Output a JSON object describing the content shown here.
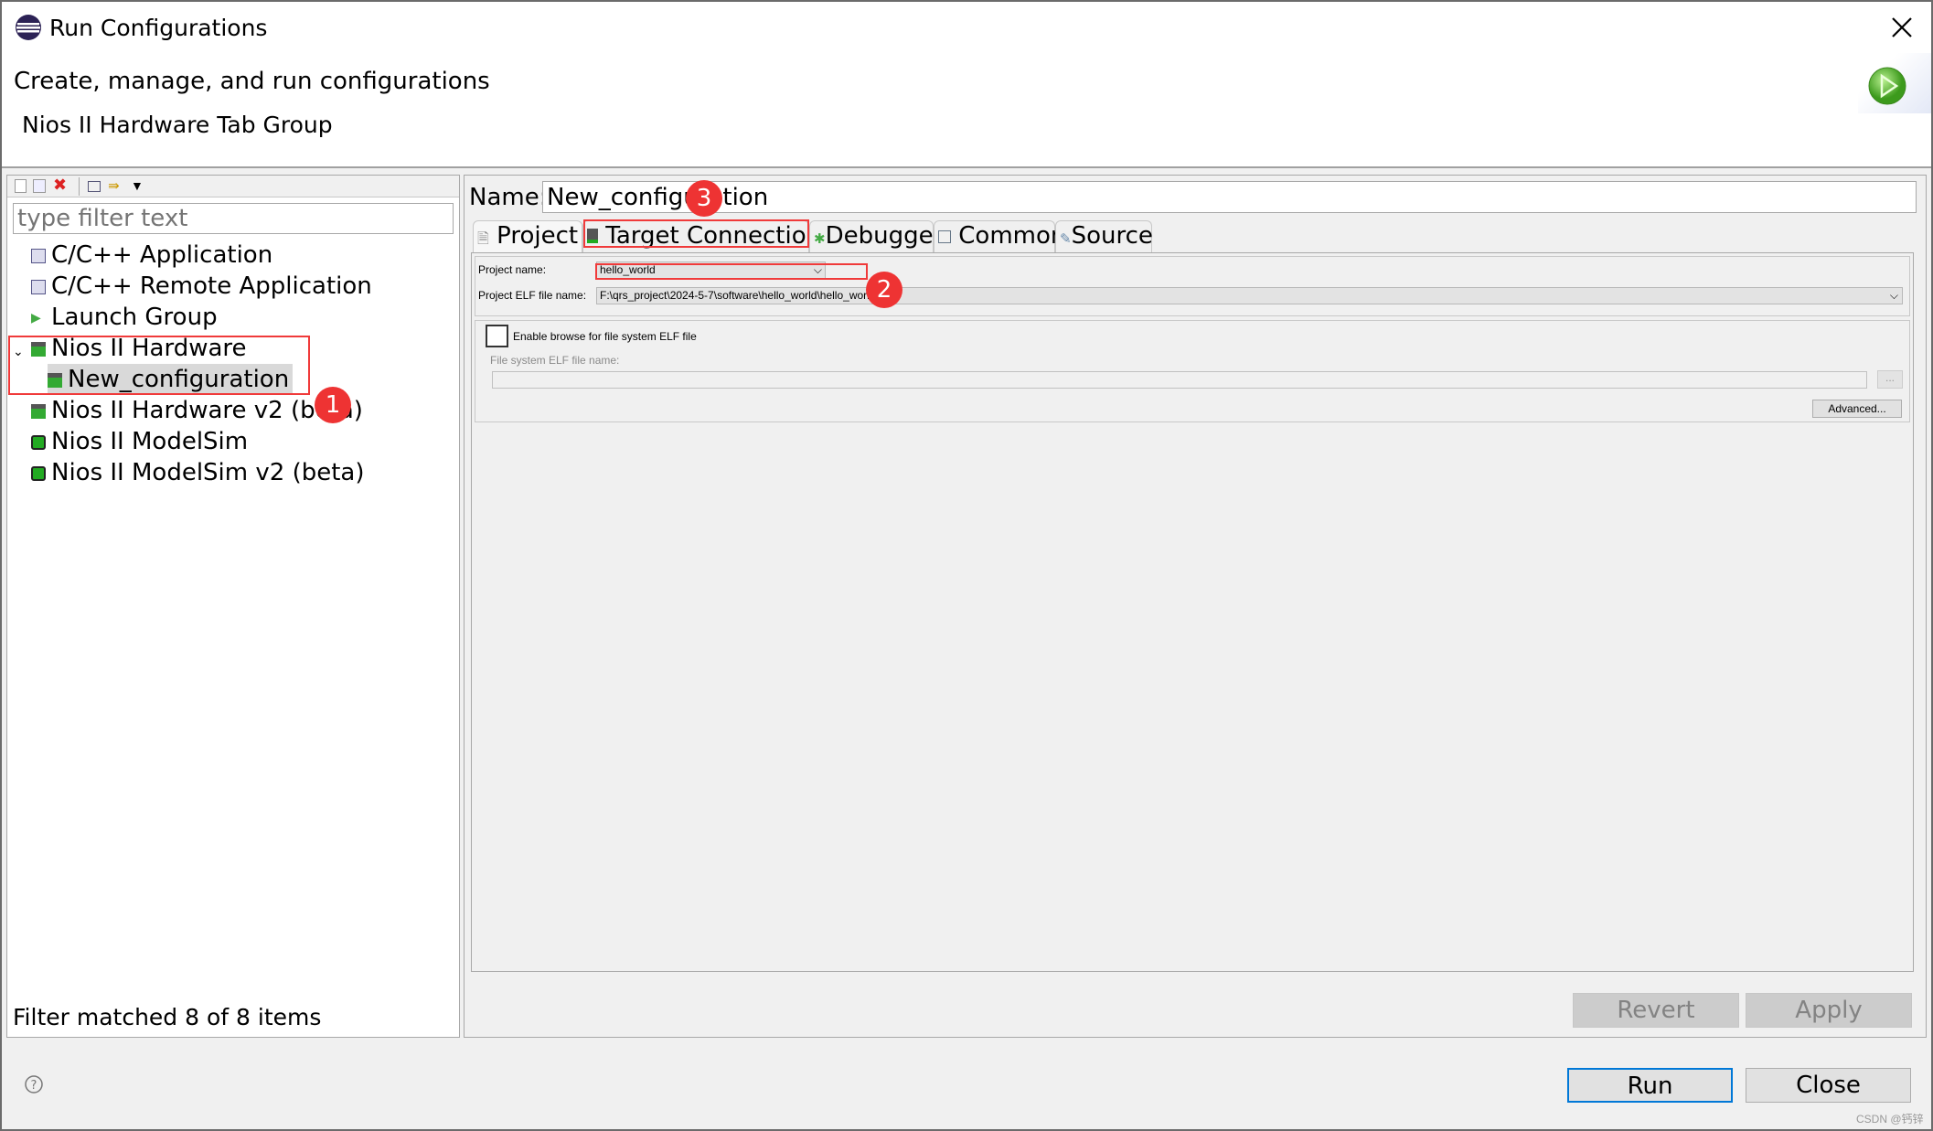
{
  "window": {
    "title": "Run Configurations",
    "close_icon": "close-icon"
  },
  "header": {
    "title": "Create, manage, and run configurations",
    "subtitle": "Nios II Hardware Tab Group"
  },
  "left": {
    "filter_placeholder": "type filter text",
    "toolbar": [
      "new-config-icon",
      "duplicate-icon",
      "delete-icon",
      "collapse-all-icon",
      "filter-icon",
      "view-menu-icon"
    ],
    "items": [
      {
        "label": "C/C++ Application",
        "icon": "c-app-icon"
      },
      {
        "label": "C/C++ Remote Application",
        "icon": "c-app-icon"
      },
      {
        "label": "Launch Group",
        "icon": "launch-group-icon"
      },
      {
        "label": "Nios II Hardware",
        "icon": "nios-hardware-icon",
        "expanded": true
      },
      {
        "label": "New_configuration",
        "icon": "nios-hardware-icon",
        "selected": true
      },
      {
        "label": "Nios II Hardware v2 (beta)",
        "icon": "nios-hardware-icon"
      },
      {
        "label": "Nios II ModelSim",
        "icon": "modelsim-icon"
      },
      {
        "label": "Nios II ModelSim v2 (beta)",
        "icon": "modelsim-icon"
      }
    ],
    "status": "Filter matched 8 of 8 items"
  },
  "right": {
    "name_label": "Name:",
    "name_value": "New_configuration",
    "tabs": [
      "Project",
      "Target Connection",
      "Debugger",
      "Common",
      "Source"
    ],
    "active_tab": "Project",
    "project_name_label": "Project name:",
    "project_name_value": "hello_world",
    "elf_label": "Project ELF file name:",
    "elf_value": "F:\\qrs_project\\2024-5-7\\software\\hello_world\\hello_world.elf",
    "enable_browse_label": "Enable browse for file system ELF file",
    "enable_browse_checked": false,
    "fs_elf_label": "File system ELF file name:",
    "fs_elf_value": "",
    "browse_label": "...",
    "advanced_label": "Advanced...",
    "revert_label": "Revert",
    "apply_label": "Apply"
  },
  "footer": {
    "run_label": "Run",
    "close_label": "Close",
    "help_icon": "help-icon"
  },
  "annotations": [
    "1",
    "2",
    "3"
  ],
  "watermark": "CSDN @钙锌",
  "colors": {
    "annotation": "#ee3333",
    "default_button_border": "#0078d7"
  }
}
